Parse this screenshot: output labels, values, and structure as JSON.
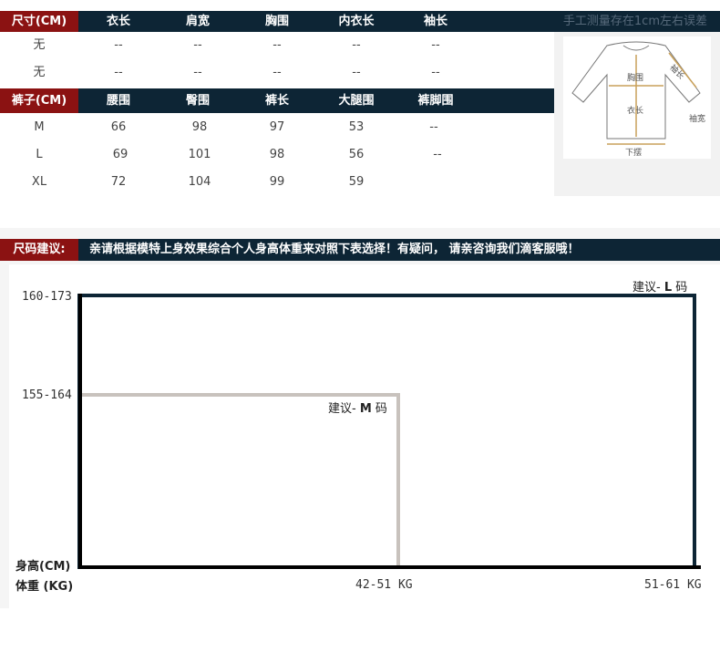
{
  "top_table": {
    "header": {
      "label": "尺寸(CM)",
      "columns": [
        "衣长",
        "肩宽",
        "胸围",
        "内衣长",
        "袖长"
      ],
      "note": "手工测量存在1cm左右误差"
    },
    "rows": [
      {
        "label": "无",
        "values": [
          "--",
          "--",
          "--",
          "--",
          "--"
        ]
      },
      {
        "label": "无",
        "values": [
          "--",
          "--",
          "--",
          "--",
          "--"
        ]
      }
    ]
  },
  "pants_table": {
    "header": {
      "label": "裤子(CM)",
      "columns": [
        "腰围",
        "臀围",
        "裤长",
        "大腿围",
        "裤脚围"
      ]
    },
    "rows": [
      {
        "label": "M",
        "values": [
          "66",
          "98",
          "97",
          "53",
          "--"
        ]
      },
      {
        "label": "L",
        "values": [
          "69",
          "101",
          "98",
          "56",
          "--"
        ]
      },
      {
        "label": "XL",
        "values": [
          "72",
          "104",
          "99",
          "59",
          ""
        ]
      }
    ]
  },
  "garment_diagram": {
    "labels": {
      "chest": "胸围",
      "sleeve": "袖长",
      "length": "衣长",
      "cuff": "袖宽",
      "hem": "下摆"
    }
  },
  "advice": {
    "label": "尺码建议:",
    "text": "亲请根据模特上身效果综合个人身高体重来对照下表选择！有疑问， 请亲咨询我们滴客服哦！"
  },
  "chart_data": {
    "type": "table",
    "y_axis_label": "身高(CM)",
    "x_axis_label": "体重 (KG)",
    "height_ranges": [
      "160-173",
      "155-164"
    ],
    "weight_ranges": [
      "42-51  KG",
      "51-61  KG"
    ],
    "recommendations": [
      {
        "prefix": "建议- ",
        "size": "M",
        "suffix": " 码",
        "height": "155-164",
        "weight": "42-51  KG"
      },
      {
        "prefix": "建议- ",
        "size": "L",
        "suffix": " 码",
        "height": "160-173",
        "weight": "51-61  KG"
      }
    ],
    "colors": {
      "l_box": "#0d2535",
      "m_box": "#c8c2bd"
    }
  },
  "colors": {
    "header_dark": "#0d2535",
    "header_red": "#8b1212"
  }
}
